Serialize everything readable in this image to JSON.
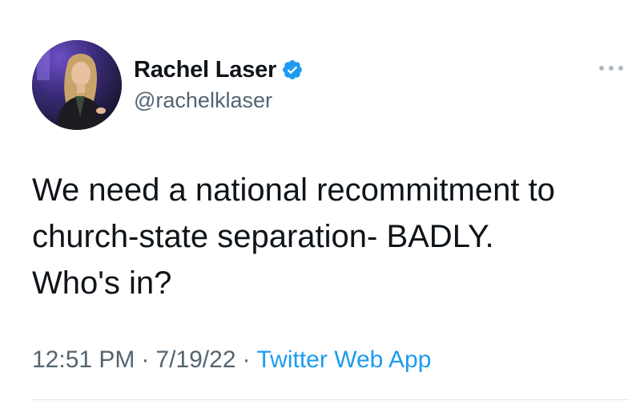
{
  "author": {
    "display_name": "Rachel Laser",
    "handle": "@rachelklaser",
    "verified": true,
    "avatar_icon": "profile-photo"
  },
  "tweet": {
    "lines": [
      "We need a national recommitment to",
      "church-state separation- BADLY.",
      "Who's in?"
    ]
  },
  "meta": {
    "time": "12:51 PM",
    "separator": "·",
    "date": "7/19/22",
    "source": "Twitter Web App"
  },
  "colors": {
    "accent": "#1d9bf0",
    "secondary_text": "#536471",
    "primary_text": "#0f1419"
  },
  "icons": {
    "verified": "verified-badge-icon",
    "more": "more-options-icon"
  }
}
